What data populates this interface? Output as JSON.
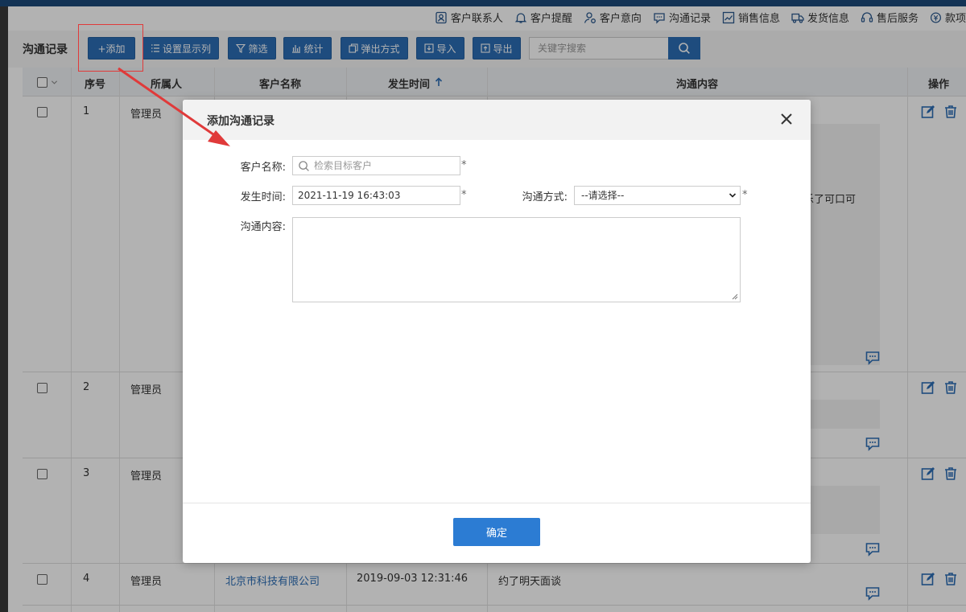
{
  "nav": {
    "items": [
      {
        "label": "客户联系人",
        "icon": "contact-icon"
      },
      {
        "label": "客户提醒",
        "icon": "bell-icon"
      },
      {
        "label": "客户意向",
        "icon": "person-icon"
      },
      {
        "label": "沟通记录",
        "icon": "chat-icon"
      },
      {
        "label": "销售信息",
        "icon": "chart-icon"
      },
      {
        "label": "发货信息",
        "icon": "truck-icon"
      },
      {
        "label": "售后服务",
        "icon": "headset-icon"
      },
      {
        "label": "款项",
        "icon": "money-icon"
      }
    ]
  },
  "toolbar": {
    "title": "沟通记录",
    "add": "+添加",
    "columns": "设置显示列",
    "filter": "筛选",
    "stats": "统计",
    "popup": "弹出方式",
    "import": "导入",
    "export": "导出",
    "search_placeholder": "关键字搜索"
  },
  "table": {
    "headers": {
      "index": "序号",
      "owner": "所属人",
      "customer": "客户名称",
      "time": "发生时间",
      "content": "沟通内容",
      "ops": "操作"
    },
    "rows": [
      {
        "index": "1",
        "owner": "管理员",
        "customer": "",
        "time": "",
        "content": "乐了可口可"
      },
      {
        "index": "2",
        "owner": "管理员",
        "customer": "",
        "time": "",
        "content": ""
      },
      {
        "index": "3",
        "owner": "管理员",
        "customer": "",
        "time": "",
        "content": ""
      },
      {
        "index": "4",
        "owner": "管理员",
        "customer": "北京市科技有限公司",
        "time": "2019-09-03 12:31:46",
        "content": "约了明天面谈"
      }
    ]
  },
  "dialog": {
    "title": "添加沟通记录",
    "customer_label": "客户名称:",
    "customer_placeholder": "检索目标客户",
    "time_label": "发生时间:",
    "time_value": "2021-11-19 16:43:03",
    "method_label": "沟通方式:",
    "method_value": "--请选择--",
    "content_label": "沟通内容:",
    "required_mark": "*",
    "confirm": "确定"
  },
  "colors": {
    "primary": "#2c6db5",
    "annotation": "#e03a3a"
  }
}
